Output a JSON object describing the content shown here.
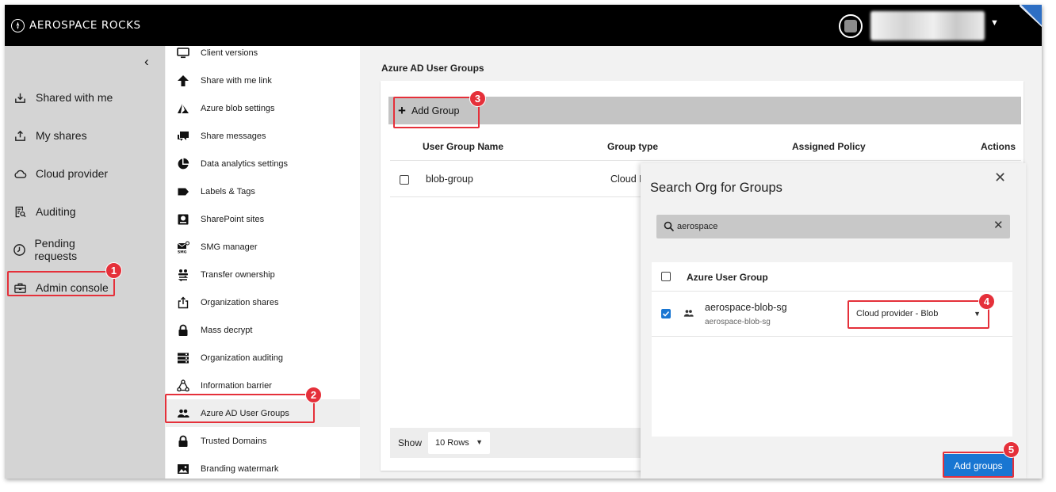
{
  "app": {
    "brand": "AEROSPACE ROCKS"
  },
  "sidebar": {
    "items": [
      {
        "label": "Shared with me",
        "icon": "download-tray-icon"
      },
      {
        "label": "My shares",
        "icon": "upload-tray-icon"
      },
      {
        "label": "Cloud provider",
        "icon": "cloud-icon"
      },
      {
        "label": "Auditing",
        "icon": "audit-icon"
      },
      {
        "label": "Pending requests",
        "icon": "clock-icon"
      },
      {
        "label": "Admin console",
        "icon": "briefcase-icon"
      }
    ]
  },
  "submenu": {
    "items": [
      {
        "label": "Client versions"
      },
      {
        "label": "Share with me link"
      },
      {
        "label": "Azure blob settings"
      },
      {
        "label": "Share messages"
      },
      {
        "label": "Data analytics settings"
      },
      {
        "label": "Labels & Tags"
      },
      {
        "label": "SharePoint sites"
      },
      {
        "label": "SMG manager"
      },
      {
        "label": "Transfer ownership"
      },
      {
        "label": "Organization shares"
      },
      {
        "label": "Mass decrypt"
      },
      {
        "label": "Organization auditing"
      },
      {
        "label": "Information barrier"
      },
      {
        "label": "Azure AD User Groups"
      },
      {
        "label": "Trusted Domains"
      },
      {
        "label": "Branding watermark"
      }
    ]
  },
  "main": {
    "title": "Azure AD User Groups",
    "add_group_label": "Add Group",
    "columns": [
      "User Group Name",
      "Group type",
      "Assigned Policy",
      "Actions"
    ],
    "rows": [
      {
        "name": "blob-group",
        "type": "Cloud I"
      }
    ],
    "footer": {
      "show_label": "Show",
      "rows_value": "10 Rows"
    }
  },
  "dialog": {
    "title": "Search Org for Groups",
    "search_value": "aerospace",
    "list_header": "Azure User Group",
    "results": [
      {
        "name": "aerospace-blob-sg",
        "sub": "aerospace-blob-sg",
        "policy": "Cloud provider - Blob",
        "checked": true
      }
    ],
    "add_button": "Add groups"
  },
  "callouts": [
    "1",
    "2",
    "3",
    "4",
    "5"
  ],
  "colors": {
    "accent": "#1976d2",
    "callout": "#e5303a",
    "topbar": "#000000",
    "sidebar": "#d4d4d4"
  }
}
